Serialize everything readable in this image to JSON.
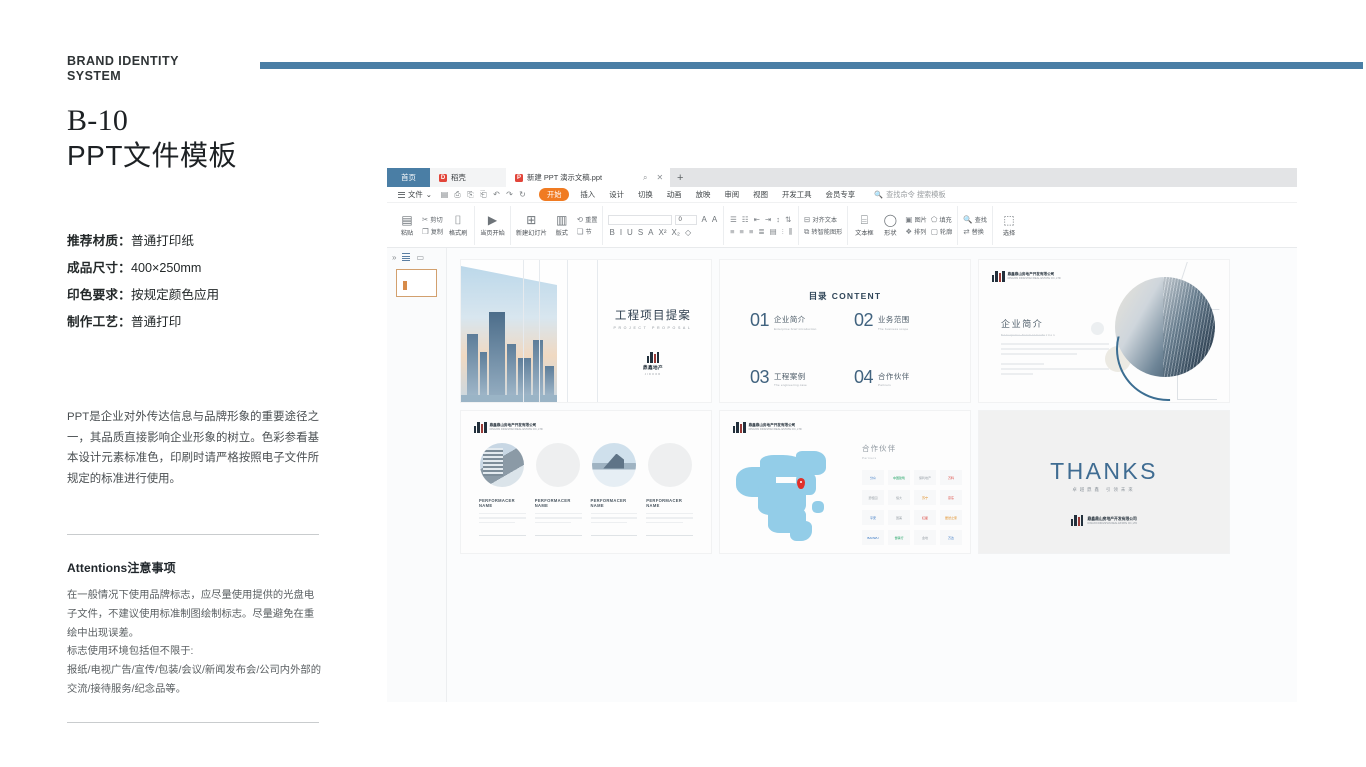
{
  "sidebar": {
    "brand_label": "BRAND IDENTITY\nSYSTEM",
    "code": "B-10",
    "title": "PPT文件模板",
    "specs": [
      {
        "key": "推荐材质：",
        "value": "普通打印纸"
      },
      {
        "key": "成品尺寸：",
        "value": "400×250mm"
      },
      {
        "key": "印色要求：",
        "value": "按规定颜色应用"
      },
      {
        "key": "制作工艺：",
        "value": "普通打印"
      }
    ],
    "intro": "PPT是企业对外传达信息与品牌形象的重要途径之一，其品质直接影响企业形象的树立。色彩参看基本设计元素标准色，印刷时请严格按照电子文件所规定的标准进行使用。",
    "attentions_title": "Attentions注意事项",
    "attentions_body": "在一般情况下使用品牌标志，应尽量使用提供的光盘电子文件，不建议使用标准制图绘制标志。尽量避免在重绘中出现误差。\n标志使用环境包括但不限于:\n报纸/电视广告/宣传/包装/会议/新闻发布会/公司内外部的交流/接待服务/纪念品等。",
    "accent_color": "#4a7ea5"
  },
  "app": {
    "tabs": {
      "home": "首页",
      "docer": "稻壳",
      "file": "新建 PPT 演示文稿.ppt",
      "add": "+"
    },
    "tab_actions": {
      "pin": "⌕",
      "close": "✕"
    },
    "menu": {
      "file": "文件",
      "items": [
        "插入",
        "设计",
        "切换",
        "动画",
        "放映",
        "审阅",
        "视图",
        "开发工具",
        "会员专享"
      ],
      "active": "开始",
      "search_placeholder": "查找命令  搜索模板"
    },
    "ribbon": {
      "paste": "粘贴",
      "cut": "剪切",
      "copy": "复制",
      "format_painter": "格式刷",
      "from_current": "当页开始",
      "new_slide": "新建幻灯片",
      "layout": "版式",
      "section": "节",
      "reset": "重置",
      "font_name": "",
      "font_size": "0",
      "bold": "B",
      "italic": "I",
      "underline": "U",
      "strike": "S",
      "font_color": "A",
      "superscript": "X²",
      "subscript": "X₂",
      "clear_format": "◇",
      "grow_font": "A",
      "shrink_font": "A",
      "align_text": "对齐文本",
      "to_smartart": "转智能图形",
      "textbox": "文本框",
      "shape": "形状",
      "picture": "图片",
      "fill": "填充",
      "arrange": "排列",
      "outline": "轮廓",
      "find": "查找",
      "replace": "替换",
      "select": "选择"
    },
    "thumbnail_panel": {
      "slide_number": "1"
    }
  },
  "slides": [
    {
      "id": "slide-1",
      "title": "工程项目提案",
      "subtitle": "PROJECT PROPOSAL",
      "logo_name": "鼎鑫地产",
      "logo_en": "JIDOOR"
    },
    {
      "id": "slide-2",
      "heading_cn": "目录",
      "heading_en": "CONTENT",
      "items": [
        {
          "num": "01",
          "cn": "企业简介",
          "en": "Enterprise brief introduction"
        },
        {
          "num": "02",
          "cn": "业务范围",
          "en": "The business scope"
        },
        {
          "num": "03",
          "cn": "工程案例",
          "en": "The engineering case"
        },
        {
          "num": "04",
          "cn": "合作伙伴",
          "en": "Partners"
        }
      ]
    },
    {
      "id": "slide-3",
      "corner_logo_cn": "鼎鑫鼎山房地产开发有限公司",
      "corner_logo_en": "DINGXIN DINGSHAN REAL ESTATE CO.,LTD",
      "title_cn": "企业简介",
      "title_en": "Enterprise brief introduction"
    },
    {
      "id": "slide-4",
      "corner_logo_cn": "鼎鑫鼎山房地产开发有限公司",
      "corner_logo_en": "DINGXIN DINGSHAN REAL ESTATE CO.,LTD",
      "cards": [
        {
          "name": "PERFORMACER NAME"
        },
        {
          "name": "PERFORMACER NAME"
        },
        {
          "name": "PERFORMACER NAME"
        },
        {
          "name": "PERFORMACER NAME"
        }
      ]
    },
    {
      "id": "slide-5",
      "corner_logo_cn": "鼎鑫鼎山房地产开发有限公司",
      "corner_logo_en": "DINGXIN DINGSHAN REAL ESTATE CO.,LTD",
      "title_cn": "合作伙伴",
      "title_en": "Partners",
      "partner_logos": [
        "分众",
        "中国建筑",
        "保利地产",
        "万科",
        "碧桂园",
        "恒大",
        "苏宁",
        "京东",
        "平安",
        "国美",
        "红星",
        "居然之家",
        "BAOWU",
        "世联行",
        "金地",
        "万达"
      ]
    },
    {
      "id": "slide-6",
      "thanks": "THANKS",
      "subtitle": "卓越鼎鑫   引领未来",
      "logo_cn": "鼎鑫鼎山房地产开发有限公司",
      "logo_en": "DINGXIN DINGSHAN REAL ESTATE CO.,LTD"
    }
  ]
}
